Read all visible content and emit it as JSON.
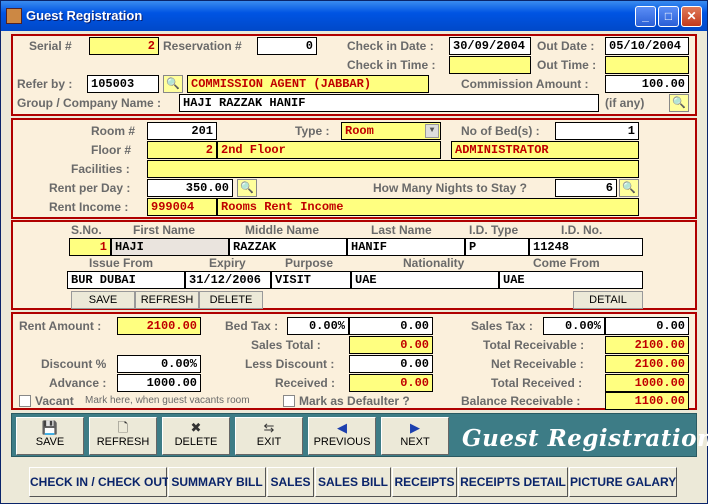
{
  "window": {
    "title": "Guest Registration"
  },
  "top": {
    "serial_label": "Serial #",
    "serial": "2",
    "reservation_label": "Reservation #",
    "reservation": "0",
    "checkin_date_label": "Check in Date :",
    "checkin_date": "30/09/2004",
    "out_date_label": "Out Date :",
    "out_date": "05/10/2004",
    "checkin_time_label": "Check in Time :",
    "checkin_time": "",
    "out_time_label": "Out Time :",
    "out_time": "",
    "refer_label": "Refer by :",
    "refer_code": "105003",
    "refer_name": "COMMISSION AGENT (JABBAR)",
    "commission_label": "Commission Amount :",
    "commission": "100.00",
    "group_label": "Group / Company Name :",
    "group": "HAJI RAZZAK HANIF",
    "if_any": "(if any)"
  },
  "room": {
    "room_label": "Room #",
    "room": "201",
    "type_label": "Type :",
    "type": "Room",
    "beds_label": "No of Bed(s) :",
    "beds": "1",
    "floor_label": "Floor #",
    "floor": "2",
    "floor_name": "2nd Floor",
    "floor_admin": "ADMINISTRATOR",
    "facilities_label": "Facilities :",
    "facilities": "",
    "rent_day_label": "Rent per Day :",
    "rent_day": "350.00",
    "nights_label": "How Many Nights to Stay ?",
    "nights": "6",
    "rent_income_label": "Rent Income :",
    "rent_income_code": "999004",
    "rent_income_name": "Rooms Rent Income"
  },
  "guests": {
    "headers": {
      "sno": "S.No.",
      "first": "First Name",
      "middle": "Middle Name",
      "last": "Last Name",
      "idtype": "I.D. Type",
      "idno": "I.D. No."
    },
    "headers2": {
      "issue": "Issue From",
      "expiry": "Expiry",
      "purpose": "Purpose",
      "nationality": "Nationality",
      "come_from": "Come From"
    },
    "row": {
      "sno": "1",
      "first": "HAJI",
      "middle": "RAZZAK",
      "last": "HANIF",
      "idtype": "P",
      "idno": "11248",
      "issue": "BUR DUBAI",
      "expiry": "31/12/2006",
      "purpose": "VISIT",
      "nationality": "UAE",
      "come_from": "UAE"
    },
    "buttons": {
      "save": "SAVE",
      "refresh": "REFRESH",
      "delete": "DELETE",
      "detail": "DETAIL"
    }
  },
  "totals": {
    "rent_amount_label": "Rent Amount :",
    "rent_amount": "2100.00",
    "bed_tax_label": "Bed Tax :",
    "bed_tax_pct": "0.00%",
    "bed_tax": "0.00",
    "sales_tax_label": "Sales Tax :",
    "sales_tax_pct": "0.00%",
    "sales_tax": "0.00",
    "sales_total_label": "Sales Total :",
    "sales_total": "0.00",
    "total_recv_label": "Total Receivable :",
    "total_recv": "2100.00",
    "discount_pct_label": "Discount %",
    "discount_pct": "0.00%",
    "less_discount_label": "Less Discount :",
    "less_discount": "0.00",
    "net_recv_label": "Net Receivable :",
    "net_recv": "2100.00",
    "advance_label": "Advance :",
    "advance": "1000.00",
    "received_label": "Received :",
    "received": "0.00",
    "total_received_label": "Total Received :",
    "total_received": "1000.00",
    "vacant_label": "Vacant",
    "vacant_hint": "Mark here, when guest vacants room",
    "defaulter_label": "Mark as Defaulter ?",
    "balance_label": "Balance Receivable :",
    "balance": "1100.00"
  },
  "toolbar": {
    "save": "SAVE",
    "refresh": "REFRESH",
    "delete": "DELETE",
    "exit": "EXIT",
    "previous": "PREVIOUS",
    "next": "NEXT",
    "banner": "Guest Registration"
  },
  "tabs": [
    "CHECK IN / CHECK OUT",
    "SUMMARY BILL",
    "SALES",
    "SALES BILL",
    "RECEIPTS",
    "RECEIPTS DETAIL",
    "PICTURE GALARY"
  ]
}
